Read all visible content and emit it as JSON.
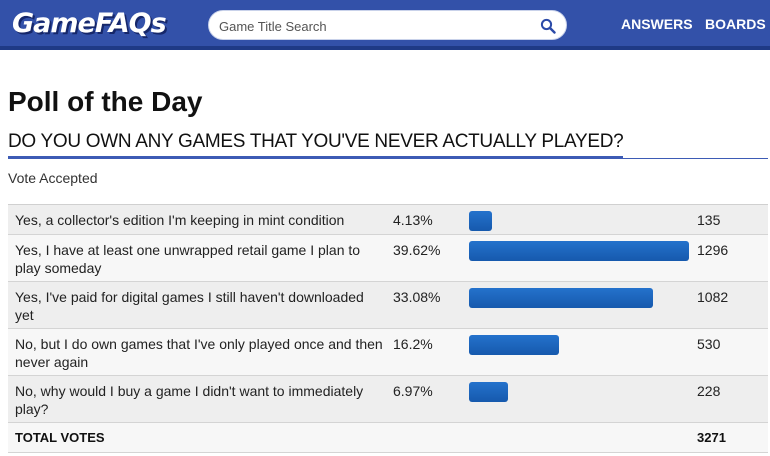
{
  "header": {
    "logo": "GameFAQs",
    "search_placeholder": "Game Title Search",
    "nav": [
      {
        "label": "ANSWERS"
      },
      {
        "label": "BOARDS"
      }
    ],
    "search_icon": "search-icon",
    "colors": {
      "bar_bg": "#3351a9",
      "bar_border": "#1f3a86"
    }
  },
  "page": {
    "title": "Poll of the Day",
    "question": "DO YOU OWN ANY GAMES THAT YOU'VE NEVER ACTUALLY PLAYED?",
    "status": "Vote Accepted"
  },
  "poll": {
    "bar_color": "#1b66c0",
    "options": [
      {
        "text": "Yes, a collector's edition I'm keeping in mint condition",
        "percent": "4.13%",
        "fraction": 0.1043,
        "votes": "135"
      },
      {
        "text": "Yes, I have at least one unwrapped retail game I plan to play someday",
        "percent": "39.62%",
        "fraction": 1.0,
        "votes": "1296"
      },
      {
        "text": "Yes, I've paid for digital games I still haven't downloaded yet",
        "percent": "33.08%",
        "fraction": 0.8349,
        "votes": "1082"
      },
      {
        "text": "No, but I do own games that I've only played once and then never again",
        "percent": "16.2%",
        "fraction": 0.4089,
        "votes": "530"
      },
      {
        "text": "No, why would I buy a game I didn't want to immediately play?",
        "percent": "6.97%",
        "fraction": 0.1759,
        "votes": "228"
      }
    ],
    "total_label": "TOTAL VOTES",
    "total_votes": "3271"
  }
}
